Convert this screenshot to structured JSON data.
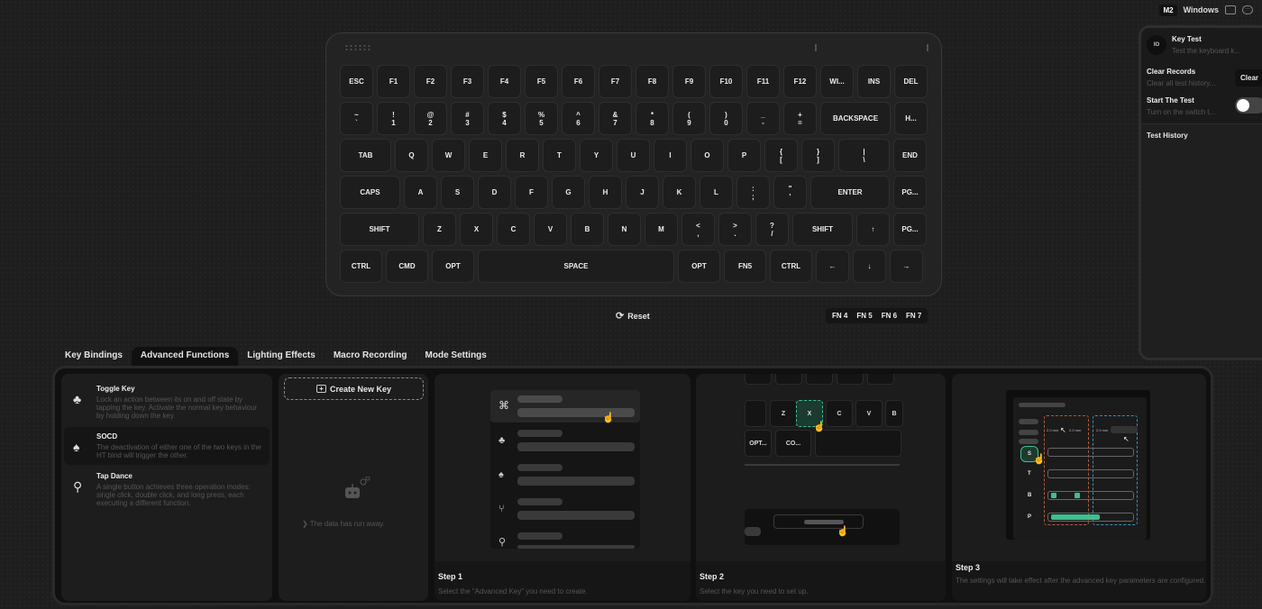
{
  "topbar": {
    "mode": "M2",
    "os": "Windows"
  },
  "keyboard": {
    "rows": [
      [
        {
          "t": "ESC",
          "w": 37
        },
        {
          "t": "F1",
          "w": 37
        },
        {
          "t": "F2",
          "w": 37
        },
        {
          "t": "F3",
          "w": 37
        },
        {
          "t": "F4",
          "w": 37
        },
        {
          "t": "F5",
          "w": 37
        },
        {
          "t": "F6",
          "w": 37
        },
        {
          "t": "F7",
          "w": 37
        },
        {
          "t": "F8",
          "w": 37
        },
        {
          "t": "F9",
          "w": 37
        },
        {
          "t": "F10",
          "w": 37
        },
        {
          "t": "F11",
          "w": 37
        },
        {
          "t": "F12",
          "w": 37
        },
        {
          "t": "WI...",
          "w": 37
        },
        {
          "t": "INS",
          "w": 37
        },
        {
          "t": "DEL",
          "w": 37
        }
      ],
      [
        {
          "t": "~",
          "b": "`",
          "w": 37
        },
        {
          "t": "!",
          "b": "1",
          "w": 37
        },
        {
          "t": "@",
          "b": "2",
          "w": 37
        },
        {
          "t": "#",
          "b": "3",
          "w": 37
        },
        {
          "t": "$",
          "b": "4",
          "w": 37
        },
        {
          "t": "%",
          "b": "5",
          "w": 37
        },
        {
          "t": "^",
          "b": "6",
          "w": 37
        },
        {
          "t": "&",
          "b": "7",
          "w": 37
        },
        {
          "t": "*",
          "b": "8",
          "w": 37
        },
        {
          "t": "(",
          "b": "9",
          "w": 37
        },
        {
          "t": ")",
          "b": "0",
          "w": 37
        },
        {
          "t": "_",
          "b": "-",
          "w": 37
        },
        {
          "t": "+",
          "b": "=",
          "w": 37
        },
        {
          "t": "BACKSPACE",
          "w": 78
        },
        {
          "t": "H...",
          "w": 37
        }
      ],
      [
        {
          "t": "TAB",
          "w": 57
        },
        {
          "t": "Q",
          "w": 37
        },
        {
          "t": "W",
          "w": 37
        },
        {
          "t": "E",
          "w": 37
        },
        {
          "t": "R",
          "w": 37
        },
        {
          "t": "T",
          "w": 37
        },
        {
          "t": "Y",
          "w": 37
        },
        {
          "t": "U",
          "w": 37
        },
        {
          "t": "I",
          "w": 37
        },
        {
          "t": "O",
          "w": 37
        },
        {
          "t": "P",
          "w": 37
        },
        {
          "t": "{",
          "b": "[",
          "w": 37
        },
        {
          "t": "}",
          "b": "]",
          "w": 37
        },
        {
          "t": "|",
          "b": "\\",
          "w": 57
        },
        {
          "t": "END",
          "w": 37
        }
      ],
      [
        {
          "t": "CAPS",
          "w": 67
        },
        {
          "t": "A",
          "w": 37
        },
        {
          "t": "S",
          "w": 37
        },
        {
          "t": "D",
          "w": 37
        },
        {
          "t": "F",
          "w": 37
        },
        {
          "t": "G",
          "w": 37
        },
        {
          "t": "H",
          "w": 37
        },
        {
          "t": "J",
          "w": 37
        },
        {
          "t": "K",
          "w": 37
        },
        {
          "t": "L",
          "w": 37
        },
        {
          "t": ":",
          "b": ";",
          "w": 37
        },
        {
          "t": "\"",
          "b": "'",
          "w": 37
        },
        {
          "t": "ENTER",
          "w": 88
        },
        {
          "t": "PG...",
          "w": 37
        }
      ],
      [
        {
          "t": "SHIFT",
          "w": 88
        },
        {
          "t": "Z",
          "w": 37
        },
        {
          "t": "X",
          "w": 37
        },
        {
          "t": "C",
          "w": 37
        },
        {
          "t": "V",
          "w": 37
        },
        {
          "t": "B",
          "w": 37
        },
        {
          "t": "N",
          "w": 37
        },
        {
          "t": "M",
          "w": 37
        },
        {
          "t": "<",
          "b": ",",
          "w": 37
        },
        {
          "t": ">",
          "b": ".",
          "w": 37
        },
        {
          "t": "?",
          "b": "/",
          "w": 37
        },
        {
          "t": "SHIFT",
          "w": 67
        },
        {
          "t": "↑",
          "w": 37
        },
        {
          "t": "PG...",
          "w": 37
        }
      ],
      [
        {
          "t": "CTRL",
          "w": 47
        },
        {
          "t": "CMD",
          "w": 47
        },
        {
          "t": "OPT",
          "w": 47
        },
        {
          "t": "SPACE",
          "w": 218
        },
        {
          "t": "OPT",
          "w": 47
        },
        {
          "t": "FN5",
          "w": 47
        },
        {
          "t": "CTRL",
          "w": 47
        },
        {
          "t": "←",
          "w": 37
        },
        {
          "t": "↓",
          "w": 37
        },
        {
          "t": "→",
          "w": 37
        }
      ]
    ]
  },
  "reset_label": "Reset",
  "fn_layers": [
    "FN 4",
    "FN 5",
    "FN 6",
    "FN 7"
  ],
  "right_panel": {
    "avatar": "IO",
    "key_test_title": "Key Test",
    "key_test_sub": "Test the keyboard k...",
    "clear_title": "Clear Records",
    "clear_sub": "Clear all test history...",
    "clear_button": "Clear",
    "start_title": "Start The Test",
    "start_sub": "Turn on the switch t...",
    "history_title": "Test History"
  },
  "tabs": [
    "Key Bindings",
    "Advanced Functions",
    "Lighting Effects",
    "Macro Recording",
    "Mode Settings"
  ],
  "functions": [
    {
      "title": "Toggle Key",
      "desc": "Lock an action between its on and off state by tapping the key. Activate the normal key behaviour by holding down the key."
    },
    {
      "title": "SOCD",
      "desc": "The deactivation of either one of the two keys in the HT bind will trigger the other."
    },
    {
      "title": "Tap Dance",
      "desc": "A single button achieves three operation modes: single click, double click, and long press, each executing a different function."
    }
  ],
  "create_new_key": "Create New Key",
  "empty_text": "The data has run away.",
  "steps": [
    {
      "title": "Step 1",
      "desc": "Select the \"Advanced Key\" you need to create."
    },
    {
      "title": "Step 2",
      "desc": "Select the key you need to set up."
    },
    {
      "title": "Step 3",
      "desc": "The settings will take effect after the advanced key parameters are configured."
    }
  ],
  "step2_keys": [
    "Z",
    "X",
    "C",
    "V",
    "B",
    "OPT...",
    "CO..."
  ],
  "step3_rows": [
    "S",
    "T",
    "B",
    "P"
  ],
  "step3_labels": [
    "2.0 mm",
    "2.0 mm",
    "2.0 mm"
  ]
}
